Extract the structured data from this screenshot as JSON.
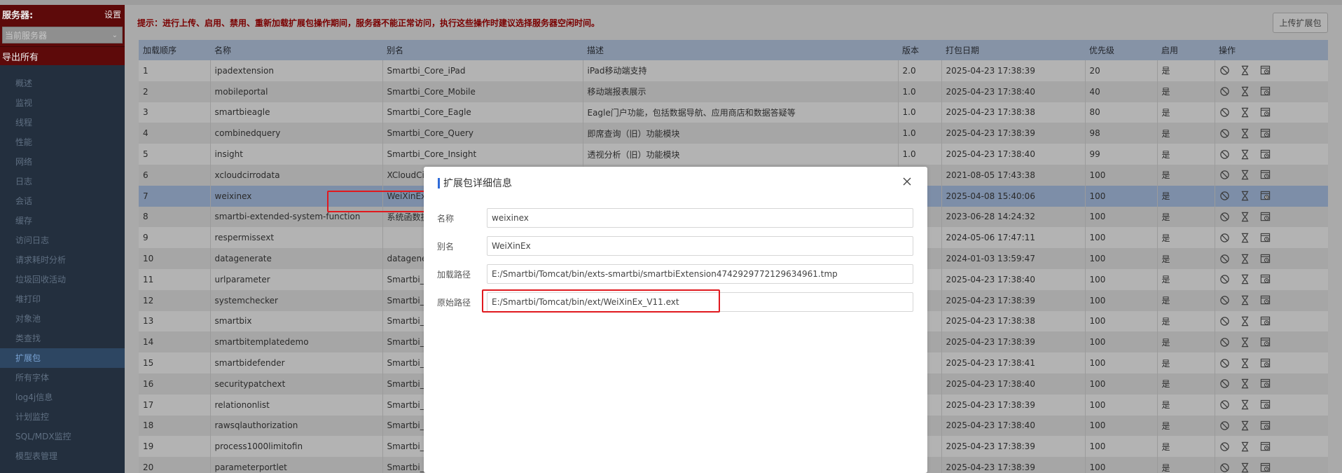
{
  "sidebar": {
    "server_label": "服务器:",
    "settings_label": "设置",
    "current_server": "当前服务器",
    "export_all": "导出所有",
    "menu": [
      {
        "label": "概述",
        "active": false
      },
      {
        "label": "监视",
        "active": false
      },
      {
        "label": "线程",
        "active": false
      },
      {
        "label": "性能",
        "active": false
      },
      {
        "label": "网络",
        "active": false
      },
      {
        "label": "日志",
        "active": false
      },
      {
        "label": "会话",
        "active": false
      },
      {
        "label": "缓存",
        "active": false
      },
      {
        "label": "访问日志",
        "active": false
      },
      {
        "label": "请求耗时分析",
        "active": false
      },
      {
        "label": "垃圾回收活动",
        "active": false
      },
      {
        "label": "堆打印",
        "active": false
      },
      {
        "label": "对象池",
        "active": false
      },
      {
        "label": "类查找",
        "active": false
      },
      {
        "label": "扩展包",
        "active": true
      },
      {
        "label": "所有字体",
        "active": false
      },
      {
        "label": "log4j信息",
        "active": false
      },
      {
        "label": "计划监控",
        "active": false
      },
      {
        "label": "SQL/MDX监控",
        "active": false
      },
      {
        "label": "模型表管理",
        "active": false
      }
    ]
  },
  "main": {
    "notice": "提示：进行上传、启用、禁用、重新加载扩展包操作期间，服务器不能正常访问，执行这些操作时建议选择服务器空闲时间。",
    "upload_button": "上传扩展包",
    "columns": [
      "加载顺序",
      "名称",
      "别名",
      "描述",
      "版本",
      "打包日期",
      "优先级",
      "启用",
      "操作"
    ],
    "selected_row": 6,
    "rows": [
      [
        "1",
        "ipadextension",
        "Smartbi_Core_iPad",
        "iPad移动端支持",
        "2.0",
        "2025-04-23 17:38:39",
        "20",
        "是"
      ],
      [
        "2",
        "mobileportal",
        "Smartbi_Core_Mobile",
        "移动端报表展示",
        "1.0",
        "2025-04-23 17:38:40",
        "40",
        "是"
      ],
      [
        "3",
        "smartbieagle",
        "Smartbi_Core_Eagle",
        "Eagle门户功能，包括数据导航、应用商店和数据答疑等",
        "1.0",
        "2025-04-23 17:38:38",
        "80",
        "是"
      ],
      [
        "4",
        "combinedquery",
        "Smartbi_Core_Query",
        "即席查询（旧）功能模块",
        "1.0",
        "2025-04-23 17:38:39",
        "98",
        "是"
      ],
      [
        "5",
        "insight",
        "Smartbi_Core_Insight",
        "透视分析（旧）功能模块",
        "1.0",
        "2025-04-23 17:38:40",
        "99",
        "是"
      ],
      [
        "6",
        "xcloudcirrodata",
        "XCloudCi",
        "",
        "",
        "2021-08-05 17:43:38",
        "100",
        "是"
      ],
      [
        "7",
        "weixinex",
        "WeiXinEx",
        "",
        "",
        "2025-04-08 15:40:06",
        "100",
        "是"
      ],
      [
        "8",
        "smartbi-extended-system-function",
        "系统函数扩",
        "",
        "",
        "2023-06-28 14:24:32",
        "100",
        "是"
      ],
      [
        "9",
        "respermissext",
        "",
        "",
        "",
        "2024-05-06 17:47:11",
        "100",
        "是"
      ],
      [
        "10",
        "datagenerate",
        "datagene",
        "",
        "",
        "2024-01-03 13:59:47",
        "100",
        "是"
      ],
      [
        "11",
        "urlparameter",
        "Smartbi_C",
        "",
        "",
        "2025-04-23 17:38:40",
        "100",
        "是"
      ],
      [
        "12",
        "systemchecker",
        "Smartbi_C",
        "",
        "",
        "2025-04-23 17:38:39",
        "100",
        "是"
      ],
      [
        "13",
        "smartbix",
        "Smartbi_C",
        "",
        "",
        "2025-04-23 17:38:38",
        "100",
        "是"
      ],
      [
        "14",
        "smartbitemplatedemo",
        "Smartbi_C",
        "",
        "",
        "2025-04-23 17:38:39",
        "100",
        "是"
      ],
      [
        "15",
        "smartbidefender",
        "Smartbi_C",
        "",
        "",
        "2025-04-23 17:38:41",
        "100",
        "是"
      ],
      [
        "16",
        "securitypatchext",
        "Smartbi_C",
        "",
        "",
        "2025-04-23 17:38:40",
        "100",
        "是"
      ],
      [
        "17",
        "relationonlist",
        "Smartbi_C",
        "",
        "",
        "2025-04-23 17:38:39",
        "100",
        "是"
      ],
      [
        "18",
        "rawsqlauthorization",
        "Smartbi_C",
        "",
        "",
        "2025-04-23 17:38:40",
        "100",
        "是"
      ],
      [
        "19",
        "process1000limitofin",
        "Smartbi_C",
        "",
        "",
        "2025-04-23 17:38:39",
        "100",
        "是"
      ],
      [
        "20",
        "parameterportlet",
        "Smartbi_C",
        "",
        "",
        "2025-04-23 17:38:39",
        "100",
        "是"
      ]
    ],
    "op_icons": [
      "disable-icon",
      "hourglass-icon",
      "reload-icon"
    ]
  },
  "modal": {
    "title": "扩展包详细信息",
    "fields": [
      {
        "label": "名称",
        "value": "weixinex"
      },
      {
        "label": "别名",
        "value": "WeiXinEx"
      },
      {
        "label": "加载路径",
        "value": "E:/Smartbi/Tomcat/bin/exts-smartbi/smartbiExtension4742929772129634961.tmp"
      },
      {
        "label": "原始路径",
        "value": "E:/Smartbi/Tomcat/bin/ext/WeiXinEx_V11.ext"
      }
    ]
  },
  "colors": {
    "sidebar_bg": "#232f3e",
    "sidebar_header_bg": "#5d0a0a",
    "notice_text": "#7a0000",
    "highlight_box": "#e0191e",
    "modal_accent": "#2f6bd8"
  }
}
